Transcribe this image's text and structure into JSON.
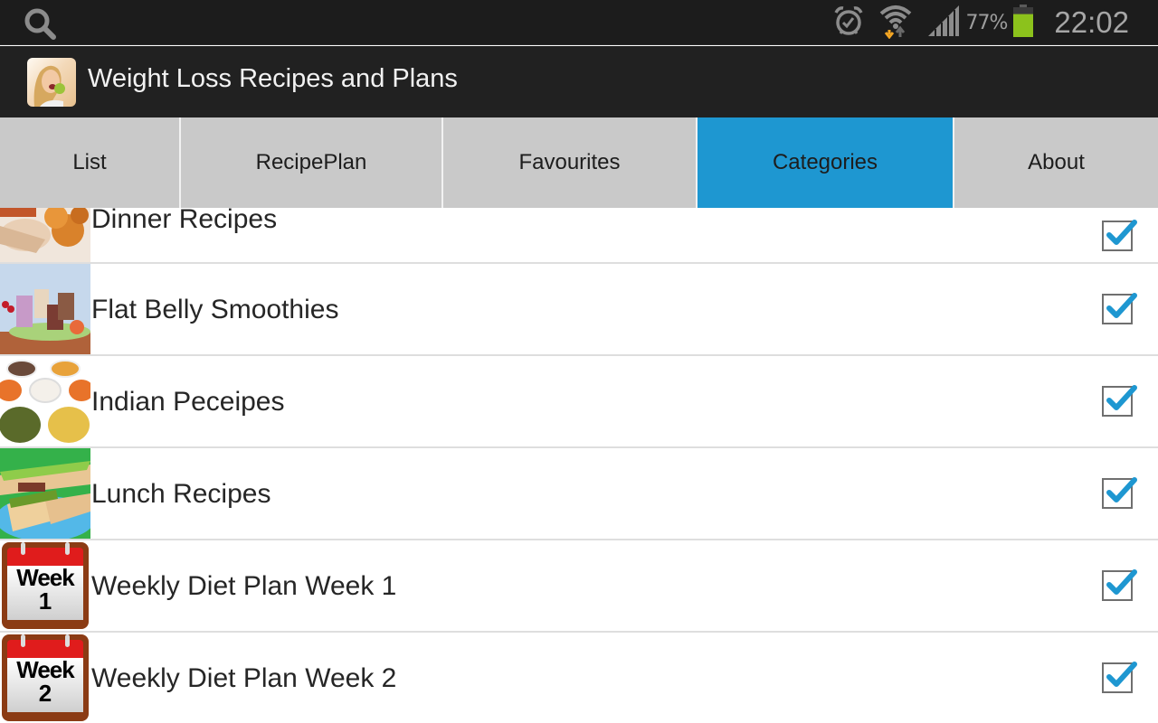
{
  "status_bar": {
    "search_icon": "search-icon",
    "icons": [
      "alarm-icon",
      "wifi-icon",
      "signal-icon",
      "battery-icon"
    ],
    "battery_percent": "77%",
    "battery_level": 0.77,
    "time": "22:02",
    "colors": {
      "battery": "#8cc21c",
      "wifi_down_arrow": "#f5a623"
    }
  },
  "action_bar": {
    "app_icon": "app-logo-woman-eating-apple",
    "title": "Weight Loss Recipes and Plans"
  },
  "tabs": [
    {
      "label": "List",
      "active": false
    },
    {
      "label": "RecipePlan",
      "active": false
    },
    {
      "label": "Favourites",
      "active": false
    },
    {
      "label": "Categories",
      "active": true
    },
    {
      "label": "About",
      "active": false
    }
  ],
  "colors": {
    "accent": "#1e97d1",
    "tab_bg": "#c9c9c9",
    "bar_bg": "#212121"
  },
  "categories": [
    {
      "label": "Dinner Recipes",
      "thumbnail": "dinner-food-photo",
      "checked": true
    },
    {
      "label": "Flat Belly Smoothies",
      "thumbnail": "smoothies-photo",
      "checked": true
    },
    {
      "label": "Indian Peceipes",
      "thumbnail": "indian-food-photo",
      "checked": true
    },
    {
      "label": "Lunch Recipes",
      "thumbnail": "lunch-sandwich-photo",
      "checked": true
    },
    {
      "label": "Weekly Diet Plan Week 1",
      "thumbnail": "calendar-week-icon",
      "calendar_word": "Week",
      "calendar_number": "1",
      "checked": true
    },
    {
      "label": "Weekly Diet Plan Week 2",
      "thumbnail": "calendar-week-icon",
      "calendar_word": "Week",
      "calendar_number": "2",
      "checked": true
    }
  ]
}
